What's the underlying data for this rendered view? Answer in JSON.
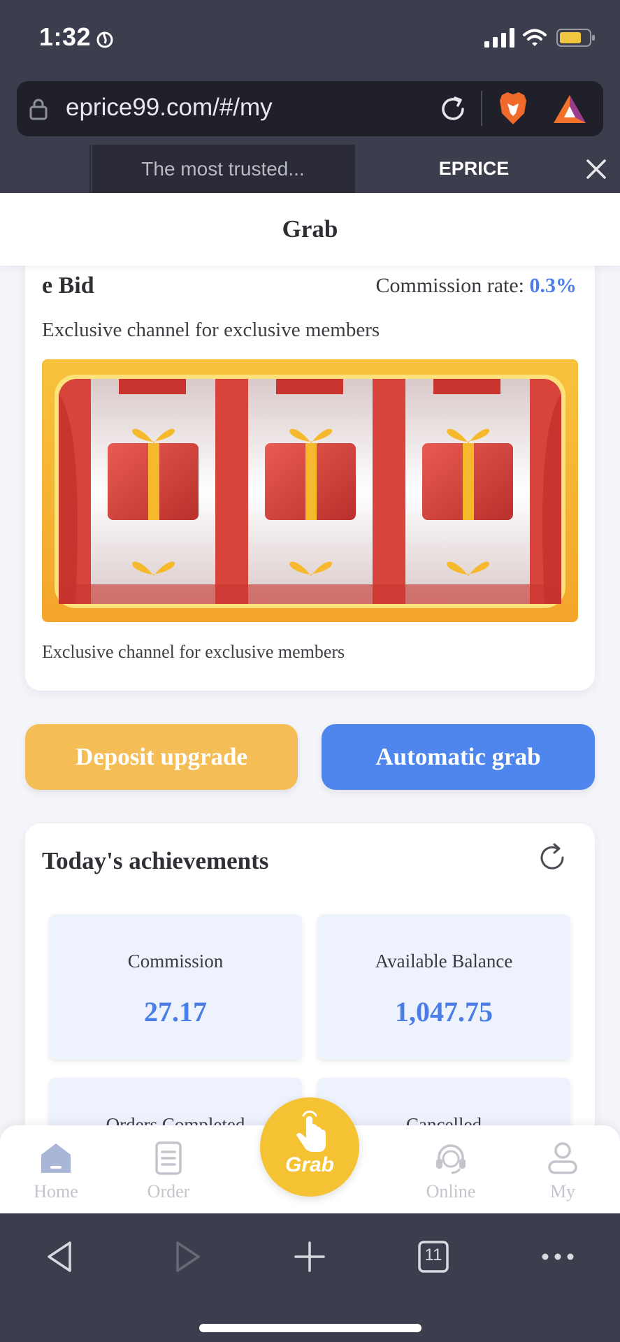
{
  "status_bar": {
    "time": "1:32"
  },
  "browser": {
    "url": "eprice99.com/#/my",
    "tabs": [
      {
        "label": "The most trusted..."
      },
      {
        "label": "EPRICE"
      }
    ]
  },
  "page": {
    "title": "Grab"
  },
  "bid_card": {
    "title": "e Bid",
    "commission_label": "Commission rate: ",
    "commission_value": "0.3%",
    "subtitle": "Exclusive channel for exclusive members",
    "footer": "Exclusive channel for exclusive members"
  },
  "buttons": {
    "deposit": "Deposit upgrade",
    "auto_grab": "Automatic grab"
  },
  "achievements": {
    "title": "Today's achievements",
    "stats": [
      {
        "label": "Commission",
        "value": "27.17"
      },
      {
        "label": "Available Balance",
        "value": "1,047.75"
      },
      {
        "label": "Orders Completed",
        "value": ""
      },
      {
        "label": "Cancelled",
        "value": ""
      }
    ]
  },
  "nav": {
    "items": [
      {
        "label": "Home",
        "icon": "home-icon"
      },
      {
        "label": "Order",
        "icon": "order-icon"
      },
      {
        "label": "Grab",
        "icon": "tap-hand-icon"
      },
      {
        "label": "Online",
        "icon": "headset-icon"
      },
      {
        "label": "My",
        "icon": "user-icon"
      }
    ]
  },
  "toolbar": {
    "tab_count": "11"
  },
  "colors": {
    "accent_blue": "#4f86ee",
    "accent_yellow": "#f5bd55",
    "grab_yellow": "#f4c232",
    "chrome": "#3c3e4e"
  }
}
